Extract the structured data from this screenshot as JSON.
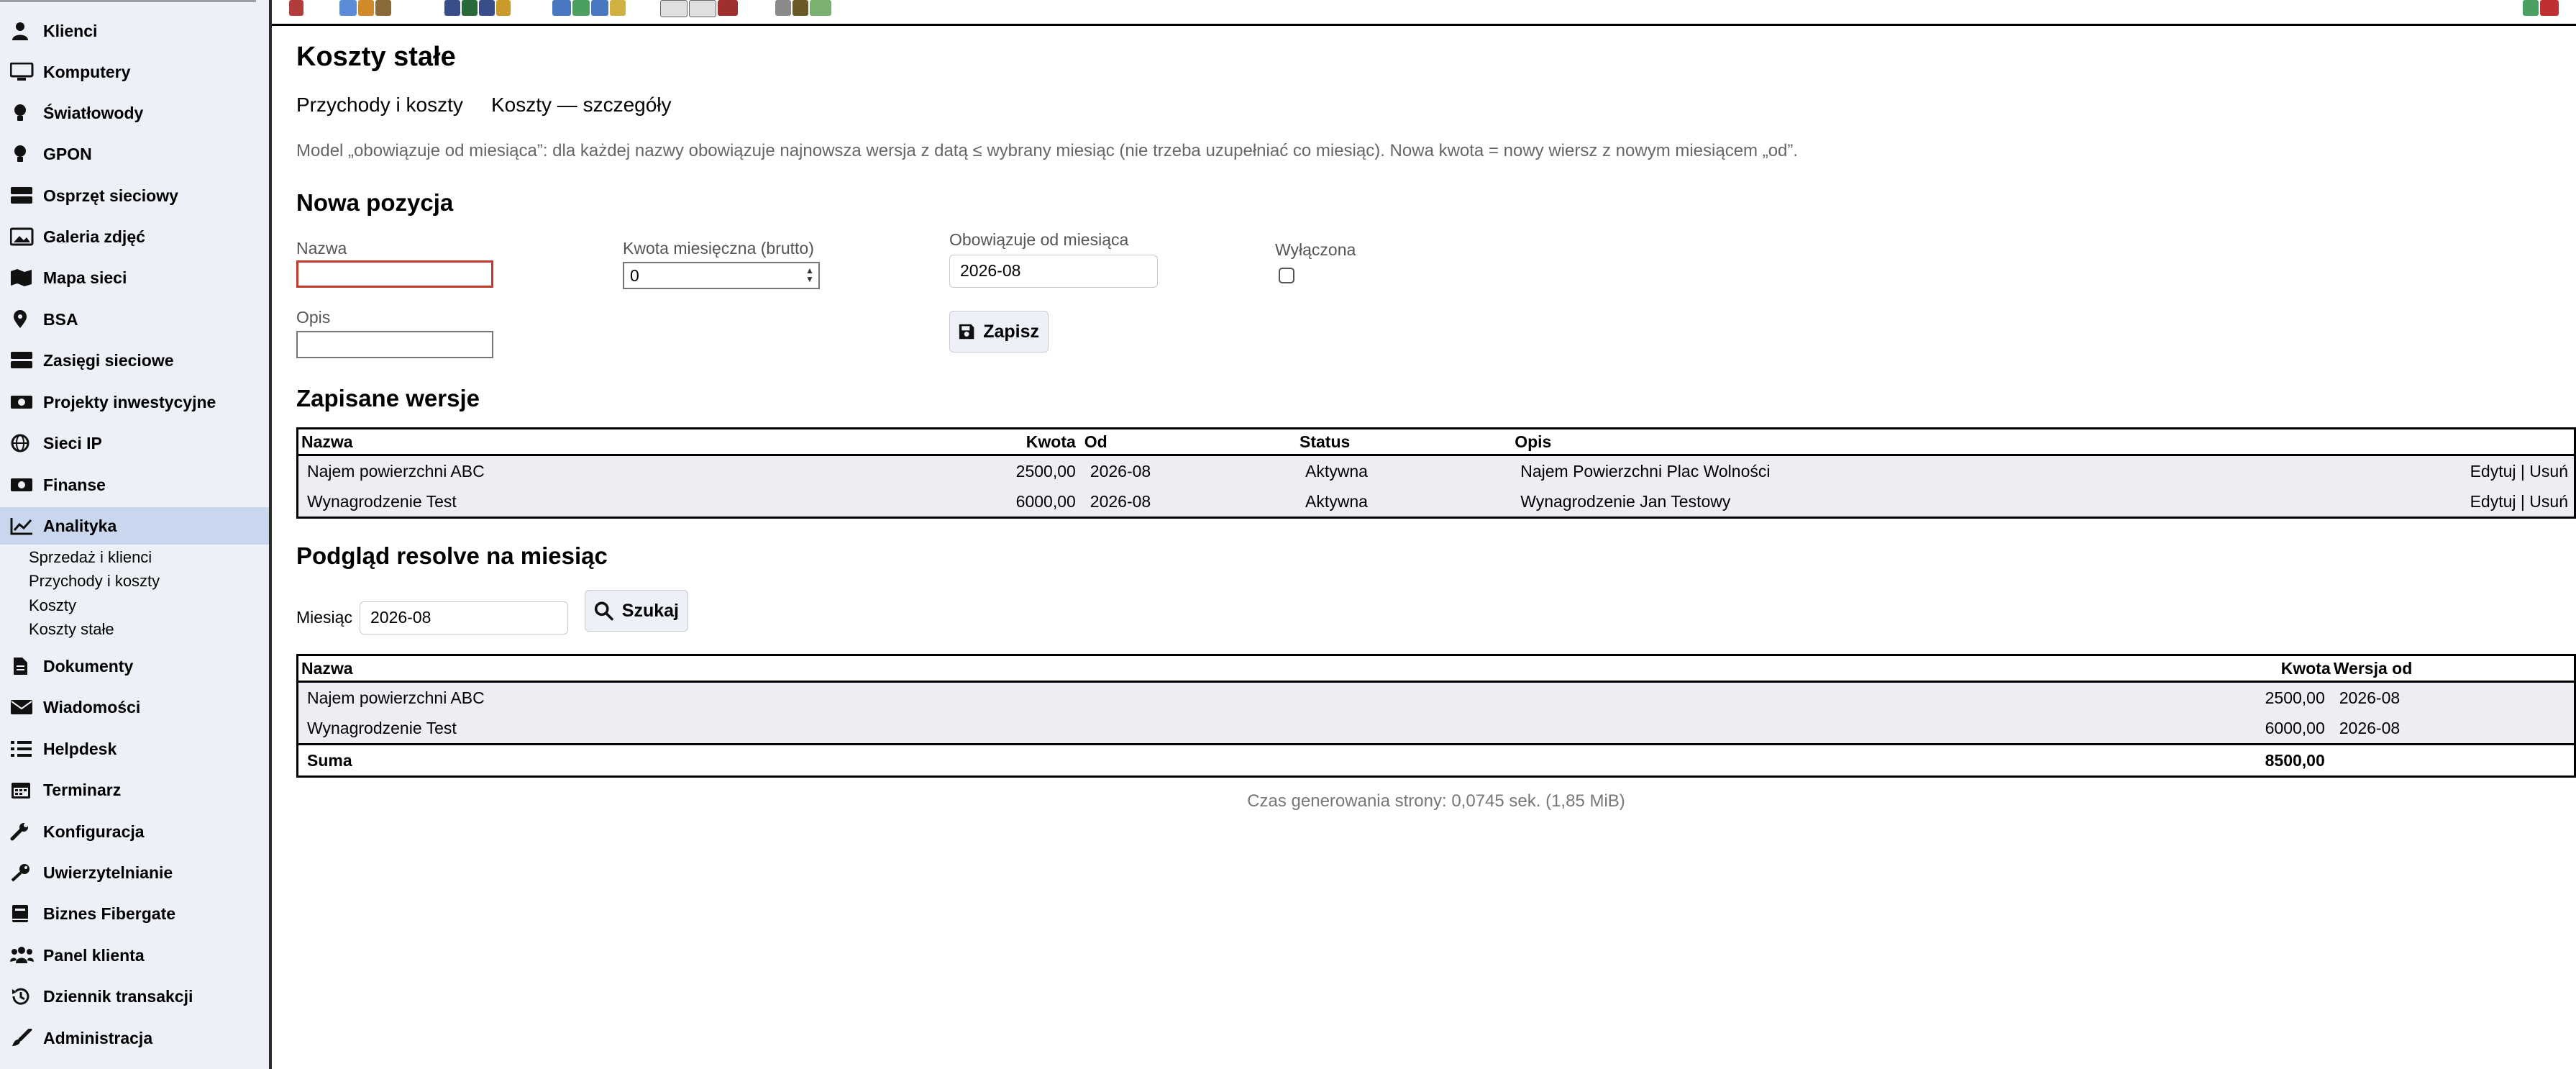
{
  "sidebar": {
    "items": [
      {
        "label": "Klienci",
        "icon": "person-icon"
      },
      {
        "label": "Komputery",
        "icon": "monitor-icon"
      },
      {
        "label": "Światłowody",
        "icon": "bulb-icon"
      },
      {
        "label": "GPON",
        "icon": "bulb-icon"
      },
      {
        "label": "Osprzęt sieciowy",
        "icon": "server-icon"
      },
      {
        "label": "Galeria zdjęć",
        "icon": "image-icon"
      },
      {
        "label": "Mapa sieci",
        "icon": "map-icon"
      },
      {
        "label": "BSA",
        "icon": "pin-icon"
      },
      {
        "label": "Zasięgi sieciowe",
        "icon": "server-icon"
      },
      {
        "label": "Projekty inwestycyjne",
        "icon": "money-icon"
      },
      {
        "label": "Sieci IP",
        "icon": "globe-icon"
      },
      {
        "label": "Finanse",
        "icon": "money-icon"
      },
      {
        "label": "Analityka",
        "icon": "chart-line-icon"
      },
      {
        "label": "Dokumenty",
        "icon": "document-icon"
      },
      {
        "label": "Wiadomości",
        "icon": "envelope-icon"
      },
      {
        "label": "Helpdesk",
        "icon": "list-icon"
      },
      {
        "label": "Terminarz",
        "icon": "calendar-icon"
      },
      {
        "label": "Konfiguracja",
        "icon": "wrench-icon"
      },
      {
        "label": "Uwierzytelnianie",
        "icon": "key-icon"
      },
      {
        "label": "Biznes Fibergate",
        "icon": "book-icon"
      },
      {
        "label": "Panel klienta",
        "icon": "users-icon"
      },
      {
        "label": "Dziennik transakcji",
        "icon": "history-icon"
      },
      {
        "label": "Administracja",
        "icon": "brush-icon"
      }
    ],
    "active_index": 12,
    "subitems": [
      "Sprzedaż i klienci",
      "Przychody i koszty",
      "Koszty",
      "Koszty stałe"
    ]
  },
  "page": {
    "title": "Koszty stałe",
    "links": [
      "Przychody i koszty",
      "Koszty — szczegóły"
    ],
    "info": "Model „obowiązuje od miesiąca”: dla każdej nazwy obowiązuje najnowsza wersja z datą ≤ wybrany miesiąc (nie trzeba uzupełniać co miesiąc). Nowa kwota = nowy wiersz z nowym miesiącem „od”."
  },
  "new_item": {
    "heading": "Nowa pozycja",
    "name_label": "Nazwa",
    "name_value": "",
    "amount_label": "Kwota miesięczna (brutto)",
    "amount_value": "0",
    "from_label": "Obowiązuje od miesiąca",
    "from_value": "2026-08",
    "disabled_label": "Wyłączona",
    "desc_label": "Opis",
    "desc_value": "",
    "save_label": "Zapisz"
  },
  "versions": {
    "heading": "Zapisane wersje",
    "columns": [
      "Nazwa",
      "Kwota",
      "Od",
      "Status",
      "Opis"
    ],
    "edit_label": "Edytuj",
    "separator": "|",
    "delete_label": "Usuń",
    "rows": [
      {
        "name": "Najem powierzchni ABC",
        "amount": "2500,00",
        "from": "2026-08",
        "status": "Aktywna",
        "desc": "Najem Powierzchni Plac Wolności"
      },
      {
        "name": "Wynagrodzenie Test",
        "amount": "6000,00",
        "from": "2026-08",
        "status": "Aktywna",
        "desc": "Wynagrodzenie Jan Testowy"
      }
    ]
  },
  "resolve": {
    "heading": "Podgląd resolve na miesiąc",
    "month_label": "Miesiąc",
    "month_value": "2026-08",
    "search_label": "Szukaj",
    "columns": [
      "Nazwa",
      "Kwota",
      "Wersja od"
    ],
    "rows": [
      {
        "name": "Najem powierzchni ABC",
        "amount": "2500,00",
        "from": "2026-08"
      },
      {
        "name": "Wynagrodzenie Test",
        "amount": "6000,00",
        "from": "2026-08"
      }
    ],
    "sum_label": "Suma",
    "sum_value": "8500,00"
  },
  "footer": "Czas generowania strony: 0,0745 sek. (1,85 MiB)",
  "toolbar": {
    "groups": [
      "toolbar-customers",
      "toolbar-network",
      "toolbar-users",
      "toolbar-computers",
      "toolbar-counters",
      "toolbar-finance"
    ]
  }
}
